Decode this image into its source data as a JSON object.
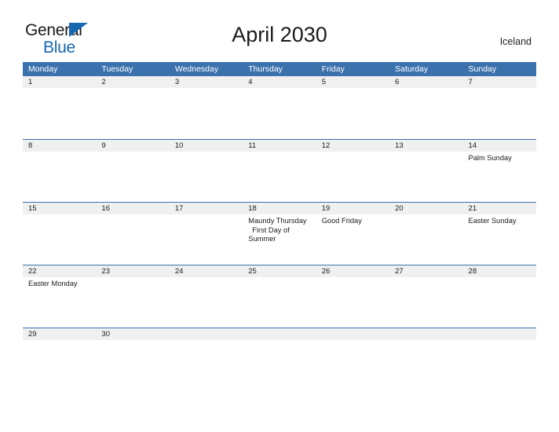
{
  "brand": {
    "name_part1": "General",
    "name_part2": "Blue",
    "logo_icon": "triangle-flag-icon",
    "colors": {
      "blue": "#1567b2",
      "black": "#1a1a1a"
    }
  },
  "header": {
    "title": "April 2030",
    "locale": "Iceland"
  },
  "theme": {
    "header_blue": "#3b72ad",
    "day_strip_gray": "#f0f0f0",
    "divider_blue": "#3b72ad",
    "text": "#1a1a1a"
  },
  "calendar": {
    "weekdays": [
      "Monday",
      "Tuesday",
      "Wednesday",
      "Thursday",
      "Friday",
      "Saturday",
      "Sunday"
    ],
    "weeks": [
      {
        "days": [
          {
            "number": "1",
            "events": []
          },
          {
            "number": "2",
            "events": []
          },
          {
            "number": "3",
            "events": []
          },
          {
            "number": "4",
            "events": []
          },
          {
            "number": "5",
            "events": []
          },
          {
            "number": "6",
            "events": []
          },
          {
            "number": "7",
            "events": []
          }
        ]
      },
      {
        "days": [
          {
            "number": "8",
            "events": []
          },
          {
            "number": "9",
            "events": []
          },
          {
            "number": "10",
            "events": []
          },
          {
            "number": "11",
            "events": []
          },
          {
            "number": "12",
            "events": []
          },
          {
            "number": "13",
            "events": []
          },
          {
            "number": "14",
            "events": [
              "Palm Sunday"
            ]
          }
        ]
      },
      {
        "days": [
          {
            "number": "15",
            "events": []
          },
          {
            "number": "16",
            "events": []
          },
          {
            "number": "17",
            "events": []
          },
          {
            "number": "18",
            "events": [
              "Maundy Thursday",
              "First Day of Summer"
            ]
          },
          {
            "number": "19",
            "events": [
              "Good Friday"
            ]
          },
          {
            "number": "20",
            "events": []
          },
          {
            "number": "21",
            "events": [
              "Easter Sunday"
            ]
          }
        ]
      },
      {
        "days": [
          {
            "number": "22",
            "events": [
              "Easter Monday"
            ]
          },
          {
            "number": "23",
            "events": []
          },
          {
            "number": "24",
            "events": []
          },
          {
            "number": "25",
            "events": []
          },
          {
            "number": "26",
            "events": []
          },
          {
            "number": "27",
            "events": []
          },
          {
            "number": "28",
            "events": []
          }
        ]
      },
      {
        "days": [
          {
            "number": "29",
            "events": []
          },
          {
            "number": "30",
            "events": []
          },
          {
            "number": "",
            "events": []
          },
          {
            "number": "",
            "events": []
          },
          {
            "number": "",
            "events": []
          },
          {
            "number": "",
            "events": []
          },
          {
            "number": "",
            "events": []
          }
        ]
      }
    ]
  }
}
